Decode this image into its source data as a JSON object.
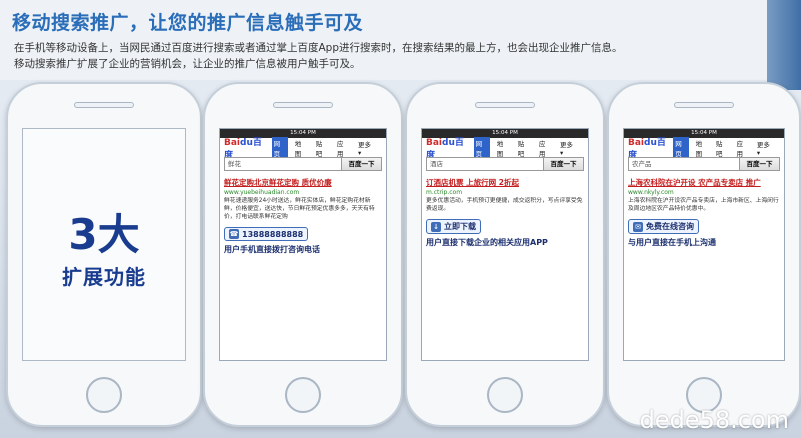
{
  "headline": "移动搜索推广，让您的推广信息触手可及",
  "intro": {
    "line1": "在手机等移动设备上，当网民通过百度进行搜索或者通过掌上百度App进行搜索时，在搜索结果的最上方，也会出现企业推广信息。",
    "line2": "移动搜索推广扩展了企业的营销机会，让企业的推广信息被用户触手可及。"
  },
  "feature_panel": {
    "big": "3大",
    "sub": "扩展功能"
  },
  "common": {
    "status_time": "15:04 PM",
    "logo_text_a": "Bai",
    "logo_text_b": "du百度",
    "tabs": [
      "网页",
      "地图",
      "贴吧",
      "应用",
      "更多 ▾"
    ],
    "search_button": "百度一下"
  },
  "phones": [
    {
      "query": "鲜花",
      "title": "鲜花定购北京鲜花定购 质优价廉",
      "url": "www.yuebeihuadian.com",
      "desc": "鲜花速递服务24小时送达，鲜花实体店，鲜花定购花材新鲜，价格便宜，送达快，节日鲜花预定优惠多多，天天有特价，打电话联系鲜花定购",
      "cta": "13888888888",
      "cta_icon": "phone-icon",
      "caption": "用户手机直接拨打咨询电话"
    },
    {
      "query": "酒店",
      "title": "订酒店机票 上旅行网 2折起",
      "url": "m.ctrip.com",
      "desc": "更多优惠活动，手机预订更便捷，成交返积分，写点评享受免费返现。",
      "cta": "立即下载",
      "cta_icon": "download-icon",
      "caption": "用户直接下载企业的相关应用APP"
    },
    {
      "query": "农产品",
      "title": "上海农科院在沪开设 农产品专卖店 推广",
      "url": "www.nkyly.com",
      "desc": "上海农科院在沪开设农产品专卖店，上海市新区、上海闵行及周边地区农产品特价优惠中。",
      "cta": "免费在线咨询",
      "cta_icon": "chat-icon",
      "caption": "与用户直接在手机上沟通"
    }
  ],
  "watermark": "dede58.com"
}
